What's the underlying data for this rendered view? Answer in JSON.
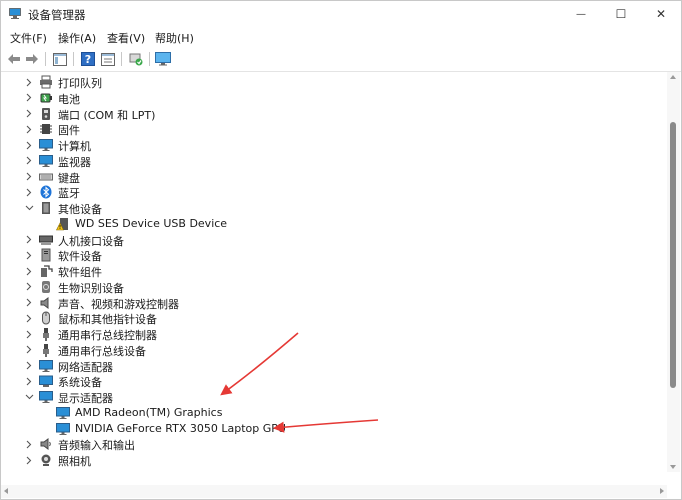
{
  "window": {
    "title": "设备管理器",
    "minimize_glyph": "—",
    "maximize_glyph": "☐",
    "close_glyph": "✕"
  },
  "menu": [
    "文件(F)",
    "操作(A)",
    "查看(V)",
    "帮助(H)"
  ],
  "toolbar": {
    "buttons": [
      "back-icon",
      "forward-icon",
      "show-hide-console-tree-icon",
      "help-icon",
      "properties-icon",
      "scan-hardware-icon",
      "monitor-icon"
    ]
  },
  "tree": {
    "items": [
      {
        "label": "打印队列",
        "icon": "printer-icon",
        "expanded": false
      },
      {
        "label": "电池",
        "icon": "battery-icon",
        "expanded": false
      },
      {
        "label": "端口 (COM 和 LPT)",
        "icon": "port-icon",
        "expanded": false
      },
      {
        "label": "固件",
        "icon": "firmware-icon",
        "expanded": false
      },
      {
        "label": "计算机",
        "icon": "computer-icon",
        "expanded": false
      },
      {
        "label": "监视器",
        "icon": "monitor-icon",
        "expanded": false
      },
      {
        "label": "键盘",
        "icon": "keyboard-icon",
        "expanded": false
      },
      {
        "label": "蓝牙",
        "icon": "bluetooth-icon",
        "expanded": false
      },
      {
        "label": "其他设备",
        "icon": "unknown-device-icon",
        "expanded": true,
        "children": [
          {
            "label": "WD SES Device USB Device",
            "icon": "warning-device-icon"
          }
        ]
      },
      {
        "label": "人机接口设备",
        "icon": "hid-icon",
        "expanded": false
      },
      {
        "label": "软件设备",
        "icon": "software-device-icon",
        "expanded": false
      },
      {
        "label": "软件组件",
        "icon": "software-component-icon",
        "expanded": false
      },
      {
        "label": "生物识别设备",
        "icon": "biometric-icon",
        "expanded": false
      },
      {
        "label": "声音、视频和游戏控制器",
        "icon": "speaker-icon",
        "expanded": false
      },
      {
        "label": "鼠标和其他指针设备",
        "icon": "mouse-icon",
        "expanded": false
      },
      {
        "label": "通用串行总线控制器",
        "icon": "usb-icon",
        "expanded": false
      },
      {
        "label": "通用串行总线设备",
        "icon": "usb-icon",
        "expanded": false
      },
      {
        "label": "网络适配器",
        "icon": "network-adapter-icon",
        "expanded": false
      },
      {
        "label": "系统设备",
        "icon": "system-device-icon",
        "expanded": false
      },
      {
        "label": "显示适配器",
        "icon": "display-adapter-icon",
        "expanded": true,
        "children": [
          {
            "label": "AMD Radeon(TM) Graphics",
            "icon": "display-adapter-icon"
          },
          {
            "label": "NVIDIA GeForce RTX 3050 Laptop GPU",
            "icon": "display-adapter-icon"
          }
        ]
      },
      {
        "label": "音频输入和输出",
        "icon": "audio-io-icon",
        "expanded": false
      },
      {
        "label": "照相机",
        "icon": "camera-icon",
        "expanded": false
      }
    ]
  },
  "colors": {
    "annotation_arrow": "#e53935",
    "monitor_blue": "#2a8fd6",
    "bluetooth_blue": "#1e74d8",
    "warning_yellow": "#f5c518"
  },
  "scrollbar": {
    "position_fraction": 0.35,
    "visible_fraction": 0.7
  }
}
